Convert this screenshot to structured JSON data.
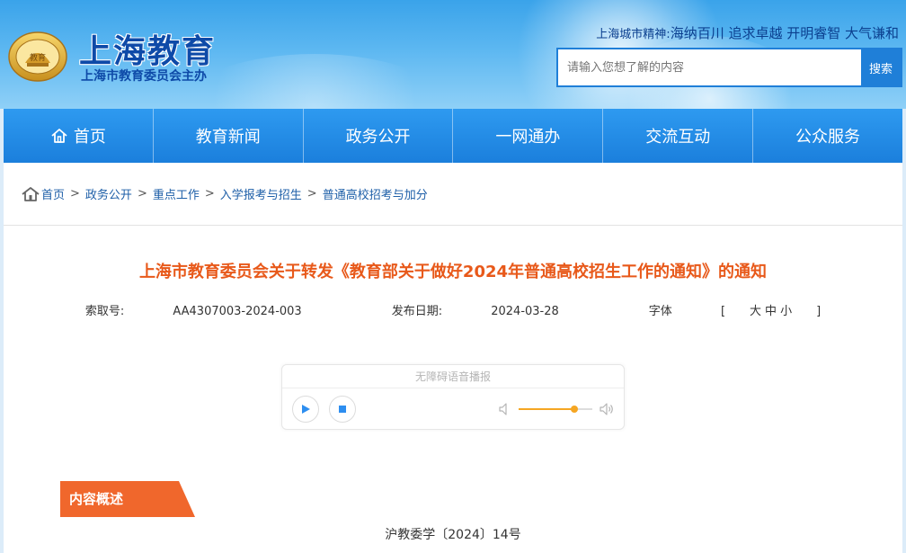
{
  "header": {
    "site_title": "上海教育",
    "site_subtitle": "上海市教育委员会主办",
    "emblem_text": "教育",
    "spirit_label": "上海城市精神:",
    "spirit_text": "海纳百川 追求卓越 开明睿智 大气谦和",
    "search": {
      "placeholder": "请输入您想了解的内容",
      "button_label": "搜索"
    }
  },
  "nav": {
    "items": [
      {
        "label": "首页",
        "icon": "home-icon"
      },
      {
        "label": "教育新闻"
      },
      {
        "label": "政务公开"
      },
      {
        "label": "一网通办"
      },
      {
        "label": "交流互动"
      },
      {
        "label": "公众服务"
      }
    ]
  },
  "breadcrumb": {
    "items": [
      "首页",
      "政务公开",
      "重点工作",
      "入学报考与招生",
      "普通高校招考与加分"
    ],
    "separator": ">"
  },
  "article": {
    "title": "上海市教育委员会关于转发《教育部关于做好2024年普通高校招生工作的通知》的通知",
    "index_label": "索取号:",
    "index_value": "AA4307003-2024-003",
    "date_label": "发布日期:",
    "date_value": "2024-03-28",
    "font_label": "字体",
    "font_open": "[",
    "font_large": "大",
    "font_medium": "中",
    "font_small": "小",
    "font_close": "]",
    "section_tag": "内容概述",
    "doc_number": "沪教委学〔2024〕14号"
  },
  "player": {
    "title": "无障碍语音播报",
    "volume": 0.75
  },
  "colors": {
    "accent_orange": "#f0672c",
    "title_orange": "#e8591a",
    "nav_blue": "#1b7fdc",
    "link_blue": "#1e5fa8",
    "volume_fill": "#f5a623"
  }
}
